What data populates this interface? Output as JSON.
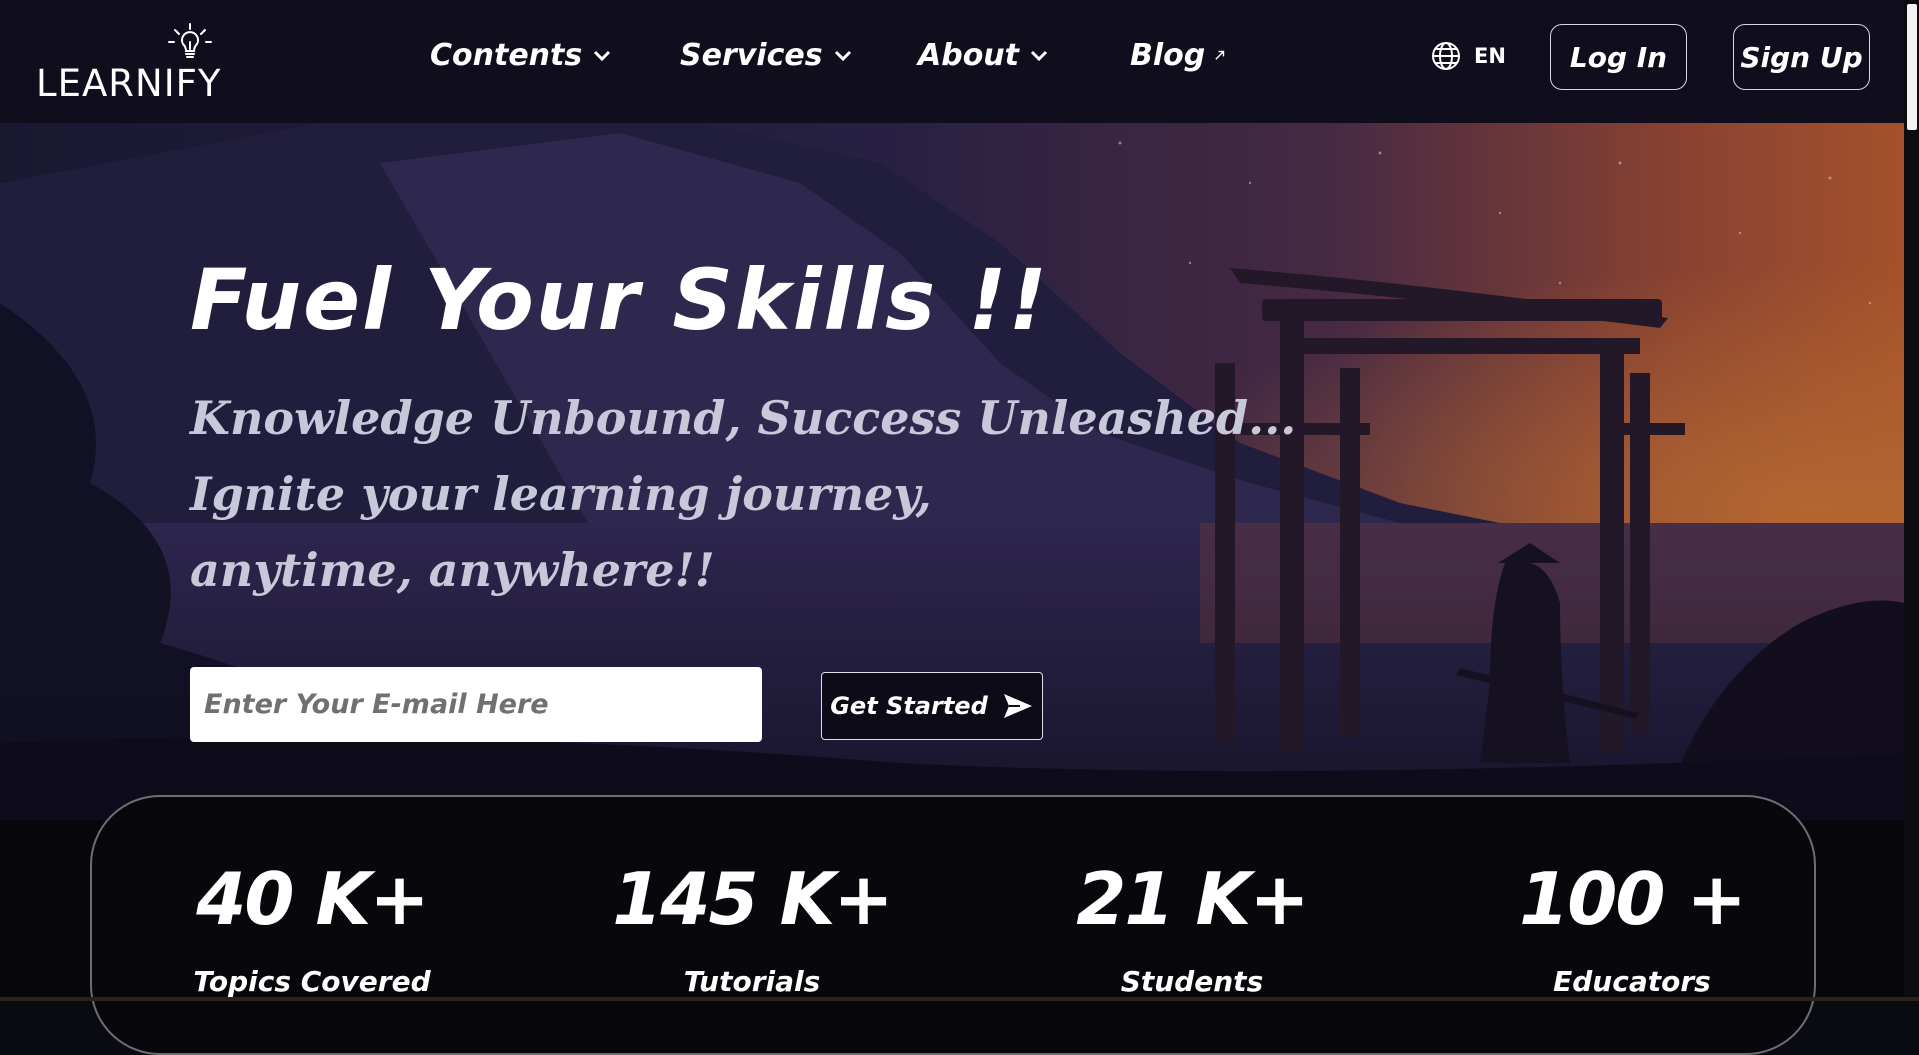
{
  "brand": {
    "name": "LEARNIFY"
  },
  "nav": {
    "items": [
      {
        "label": "Contents"
      },
      {
        "label": "Services"
      },
      {
        "label": "About"
      },
      {
        "label": "Blog"
      }
    ],
    "language": "EN",
    "login_label": "Log In",
    "signup_label": "Sign Up"
  },
  "hero": {
    "title": "Fuel Your Skills !!",
    "subtitle_lines": [
      "Knowledge Unbound, Success Unleashed...",
      "Ignite your learning journey,",
      "anytime, anywhere!!"
    ],
    "email_placeholder": "Enter Your E-mail Here",
    "cta_label": "Get Started"
  },
  "stats": [
    {
      "value": "40 K+",
      "label": "Topics Covered"
    },
    {
      "value": "145 K+",
      "label": "Tutorials"
    },
    {
      "value": "21 K+",
      "label": "Students"
    },
    {
      "value": "100 +",
      "label": "Educators"
    }
  ],
  "icons": {
    "logo": "lightbulb-icon",
    "language": "globe-icon",
    "dropdown": "chevron-down-icon",
    "external": "external-link-icon",
    "cta": "send-arrow-icon"
  },
  "colors": {
    "header_bg": "#100d1c",
    "text": "#ffffff",
    "subtitle": "#c9c8da",
    "stats_bg": "#07070c"
  }
}
